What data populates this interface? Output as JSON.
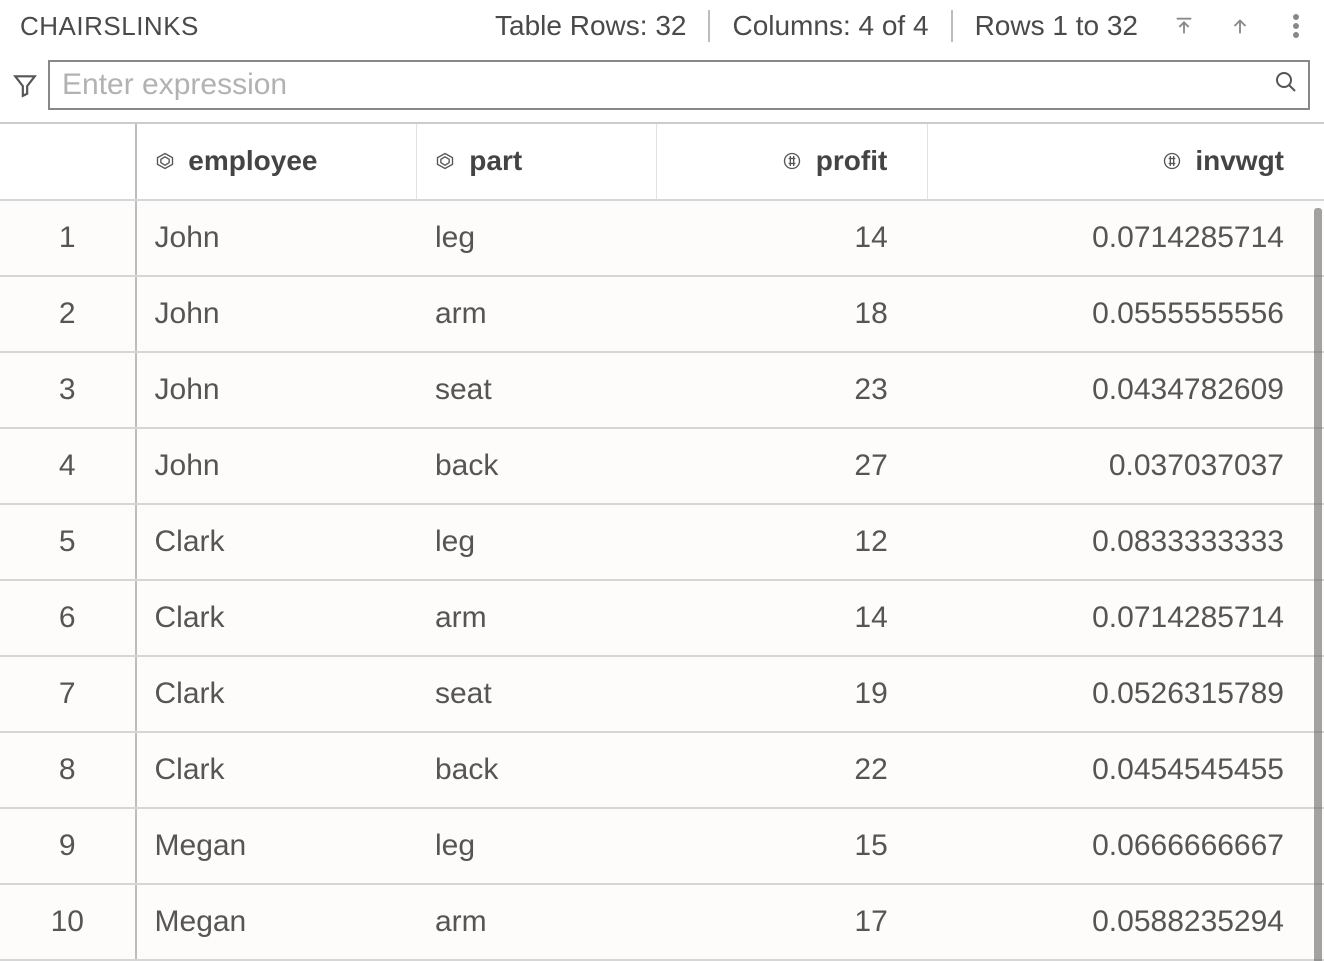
{
  "header": {
    "title": "CHAIRSLINKS",
    "rows_label": "Table Rows: 32",
    "cols_label": "Columns: 4 of 4",
    "range_label": "Rows 1 to 32"
  },
  "filter": {
    "placeholder": "Enter expression"
  },
  "columns": [
    {
      "name": "employee",
      "type": "char"
    },
    {
      "name": "part",
      "type": "char"
    },
    {
      "name": "profit",
      "type": "num"
    },
    {
      "name": "invwgt",
      "type": "num"
    }
  ],
  "rows": [
    {
      "n": "1",
      "employee": "John",
      "part": "leg",
      "profit": "14",
      "invwgt": "0.0714285714"
    },
    {
      "n": "2",
      "employee": "John",
      "part": "arm",
      "profit": "18",
      "invwgt": "0.0555555556"
    },
    {
      "n": "3",
      "employee": "John",
      "part": "seat",
      "profit": "23",
      "invwgt": "0.0434782609"
    },
    {
      "n": "4",
      "employee": "John",
      "part": "back",
      "profit": "27",
      "invwgt": "0.037037037"
    },
    {
      "n": "5",
      "employee": "Clark",
      "part": "leg",
      "profit": "12",
      "invwgt": "0.0833333333"
    },
    {
      "n": "6",
      "employee": "Clark",
      "part": "arm",
      "profit": "14",
      "invwgt": "0.0714285714"
    },
    {
      "n": "7",
      "employee": "Clark",
      "part": "seat",
      "profit": "19",
      "invwgt": "0.0526315789"
    },
    {
      "n": "8",
      "employee": "Clark",
      "part": "back",
      "profit": "22",
      "invwgt": "0.0454545455"
    },
    {
      "n": "9",
      "employee": "Megan",
      "part": "leg",
      "profit": "15",
      "invwgt": "0.0666666667"
    },
    {
      "n": "10",
      "employee": "Megan",
      "part": "arm",
      "profit": "17",
      "invwgt": "0.0588235294"
    }
  ]
}
